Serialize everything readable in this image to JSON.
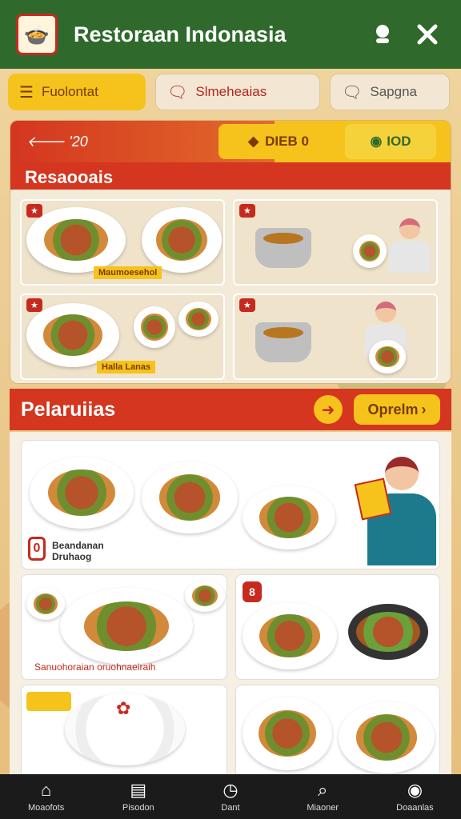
{
  "app": {
    "title": "Restoraan Indonasia",
    "logo_icon": "🍲"
  },
  "header": {
    "user_icon": "profile-icon",
    "close_icon": "close-icon"
  },
  "chips": [
    {
      "label": "Fuolontat",
      "icon": "☰"
    },
    {
      "label": "Slmeheaias",
      "icon": "🗨"
    },
    {
      "label": "Sapgna",
      "icon": "🗨"
    }
  ],
  "panel": {
    "back_label": "'20",
    "pill_1": "DIEB 0",
    "pill_2": "IOD",
    "section_title": "Resaooais",
    "cards": [
      {
        "label": "Maumoesehol"
      },
      {
        "label": ""
      },
      {
        "label": "Halla Lanas"
      },
      {
        "label": ""
      }
    ]
  },
  "section2": {
    "title": "Pelaruiias",
    "open_label": "Oprelm"
  },
  "dishes": {
    "featured_badge": "0",
    "featured_name_1": "Beandanan",
    "featured_name_2": "Druhaog",
    "mid_left_caption": "Sanuohoraian oruohnaeiraih",
    "mid_right_badge": "8"
  },
  "nav": [
    {
      "label": "Moaofots",
      "icon": "⌂"
    },
    {
      "label": "Pisodon",
      "icon": "▤"
    },
    {
      "label": "Dant",
      "icon": "◷"
    },
    {
      "label": "Miaoner",
      "icon": "⌕"
    },
    {
      "label": "Doaanlas",
      "icon": "◉"
    }
  ],
  "colors": {
    "header_green": "#2f6a2c",
    "accent_red": "#d4361f",
    "accent_yellow": "#f6c31c"
  }
}
